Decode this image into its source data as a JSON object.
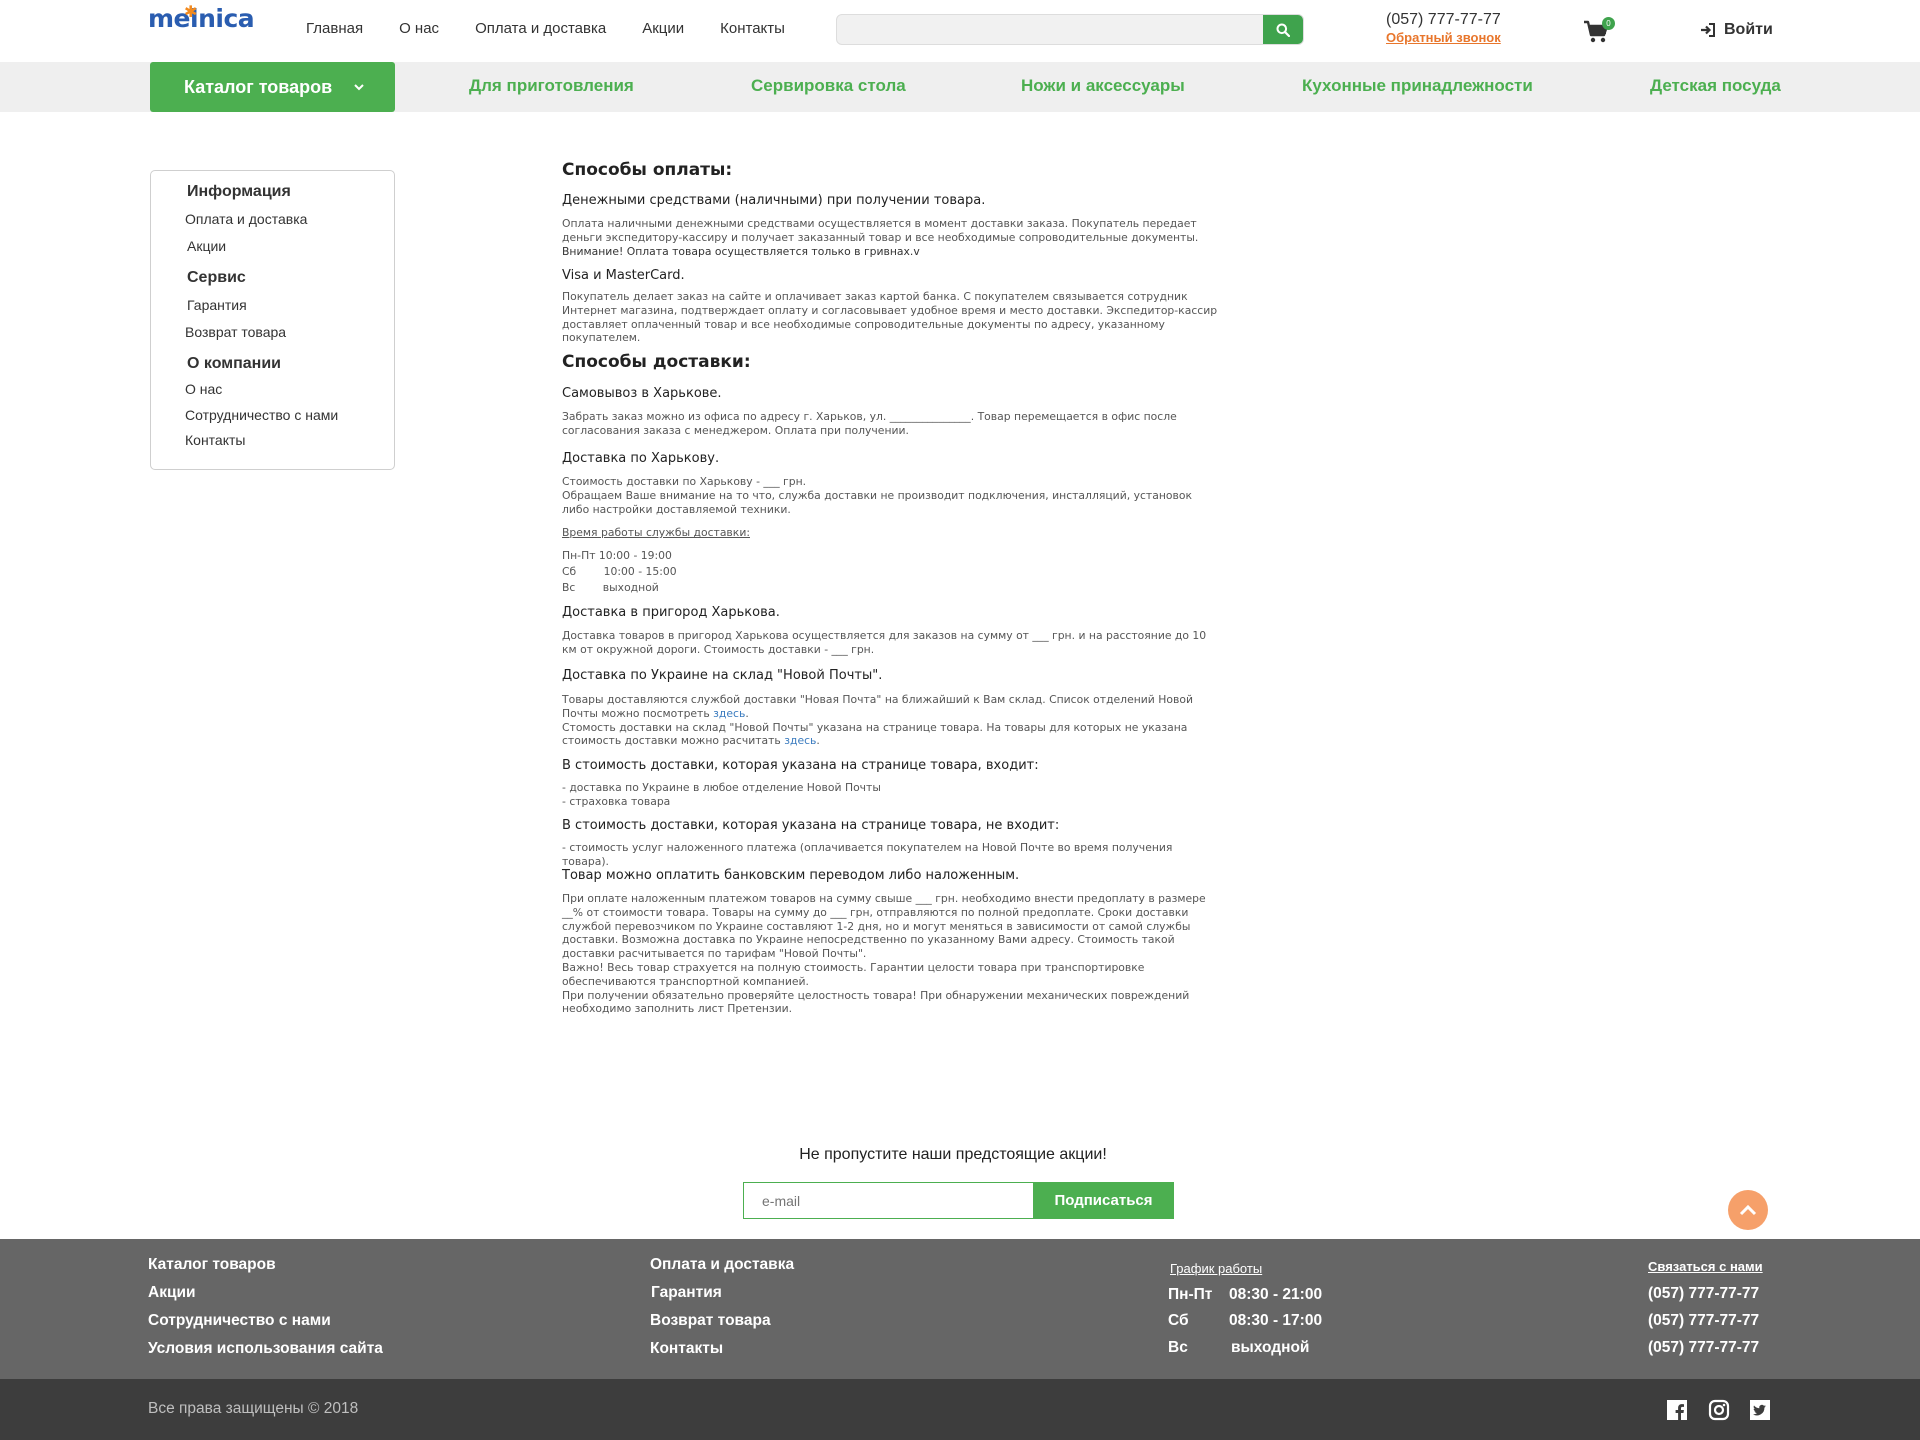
{
  "header": {
    "logo": "melnica",
    "nav": [
      "Главная",
      "О нас",
      "Оплата и доставка",
      "Акции",
      "Контакты"
    ],
    "search_placeholder": "",
    "phone": "(057) 777-77-77",
    "callback": "Обратный звонок",
    "cart_count": "0",
    "login": "Войти"
  },
  "catbar": {
    "catalog": "Каталог товаров",
    "links": [
      "Для приготовления",
      "Сервировка стола",
      "Ножи и аксессуары",
      "Кухонные принадлежности",
      "Детская посуда"
    ]
  },
  "sidebar": {
    "info_title": "Информация",
    "info_items": [
      "Оплата и доставка",
      "Акции"
    ],
    "service_title": "Сервис",
    "service_items": [
      "Гарантия",
      "Возврат товара"
    ],
    "company_title": "О компании",
    "company_items": [
      "О нас",
      "Сотрудничество с нами",
      "Контакты"
    ]
  },
  "content": {
    "payment_title": "Способы оплаты:",
    "cash_title": "Денежными средствами (наличными) при получении товара.",
    "cash_text": "Оплата наличными денежными средствами осуществляется в момент доставки заказа. Покупатель передает деньги экспедитору-кассиру и получает заказанный товар и все необходимые сопроводительные документы.",
    "cash_note": "Внимание! Оплата товара осуществляется только в гривнах.v",
    "card_title": "Visa и MasterCard.",
    "card_text": "Покупатель делает заказ на сайте и оплачивает заказ картой банка. С покупателем связывается сотрудник Интернет магазина, подтверждает оплату и согласовывает удобное время и место доставки. Экспедитор-кассир доставляет оплаченный товар и все необходимые сопроводительные документы по адресу, указанному покупателем.",
    "delivery_title": "Способы доставки:",
    "pickup_title": "Самовывоз в Харькове.",
    "pickup_text": "Забрать заказ можно из офиса по адресу г. Харьков, ул. _______________.  Товар перемещается в офис после согласования заказа с менеджером.  Оплата при получении.",
    "city_title": "Доставка по Харькову.",
    "city_cost": "Стоимость доставки по Харькову - ___ грн.",
    "city_note": "Обращаем Ваше внимание на то что, служба доставки не производит подключения,  инсталляций, установок либо настройки доставляемой техники.",
    "hours_label": "Время работы службы доставки:",
    "hours": [
      "Пн-Пт 10:00 - 19:00",
      "Сб        10:00 - 15:00",
      "Вс        выходной"
    ],
    "suburb_title": "Доставка в пригород Харькова.",
    "suburb_text": "Доставка товаров в пригород Харькова осуществляется для заказов на сумму  от ___ грн. и на расстояние до 10 км от окружной дороги.  Стоимость доставки - ___ грн.",
    "np_title": "Доставка по Украине на склад \"Новой Почты\".",
    "np_text1": "Товары доставляются службой доставки \"Новая Почта\" на ближайший к Вам склад. Список отделений Новой Почты можно посмотреть",
    "np_text2": "Стомость доставки на склад \"Новой Почты\" указана на странице товара. На товары для которых не указана стоимость доставки можно расчитать",
    "np_link": "здесь",
    "incl_title": "В стоимость доставки, которая указана на странице товара, входит:",
    "incl_items": [
      "- доставка по Украине в любое отделение Новой Почты",
      "- страховка товара"
    ],
    "excl_title": "В стоимость доставки, которая указана на странице товара, не входит:",
    "excl_items": [
      "- стоимость услуг наложенного платежа (оплачивается покупателем на Новой Почте во время получения товара)."
    ],
    "bank_title": "Товар можно оплатить банковским переводом либо наложенным.",
    "bank_text": "При оплате наложенным платежом товаров на сумму свыше ___ грн. необходимо внести предоплату в размере __% от стоимости товара. Товары на сумму до ___ грн, отправляются по полной предоплате. Сроки доставки службой перевозчиком по Украине составляют 1-2 дня, но и могут меняться в зависимости от самой службы доставки. Возможна доставка по Украине непосредственно по указанному Вами адресу. Стоимость такой доставки расчитывается по тарифам \"Новой Почты\".",
    "bank_text2": "Важно! Весь товар страхуется на полную стоимость. Гарантии целости товара при транспортировке обеспечиваются транспортной компанией.",
    "bank_text3": "При получении обязательно проверяйте целостность товара! При обнаружении механических повреждений необходимо заполнить лист Претензии."
  },
  "subscribe": {
    "title": "Не пропустите наши предстоящие акции!",
    "placeholder": "e-mail",
    "button": "Подписаться"
  },
  "footer": {
    "col1": [
      "Каталог товаров",
      "Акции",
      "Сотрудничество с нами",
      "Условия использования сайта"
    ],
    "col2": [
      "Оплата и доставка",
      "Гарантия",
      "Возврат товара",
      "Контакты"
    ],
    "schedule_label": "График работы",
    "schedule": [
      {
        "day": "Пн-Пт",
        "time": "08:30 - 21:00"
      },
      {
        "day": "Сб",
        "time": "08:30 - 17:00"
      },
      {
        "day": "Вс",
        "time": "выходной"
      }
    ],
    "contact_label": "Связаться с нами",
    "phones": [
      "(057) 777-77-77",
      "(057) 777-77-77",
      "(057) 777-77-77"
    ],
    "copyright": "Все права защищены © 2018"
  },
  "icons": {
    "search": "search-icon",
    "cart": "cart-icon",
    "login": "sign-in-icon",
    "chevron": "chevron-down-icon",
    "to_top": "chevron-up-icon",
    "facebook": "facebook-icon",
    "instagram": "instagram-icon",
    "twitter": "twitter-icon"
  },
  "colors": {
    "accent_green": "#4caf50",
    "accent_orange": "#e8762c",
    "footer_bg": "#666666",
    "bottom_bg": "#3d3d3d"
  }
}
